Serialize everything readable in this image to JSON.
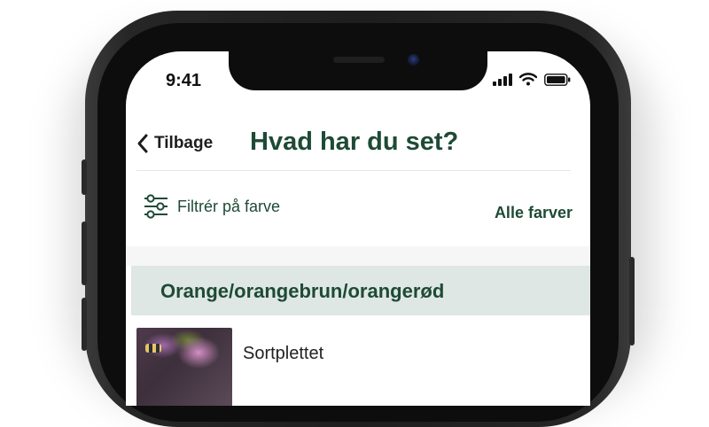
{
  "status_bar": {
    "time": "9:41"
  },
  "header": {
    "back_label": "Tilbage",
    "title": "Hvad har du set?"
  },
  "filter": {
    "label": "Filtrér på farve",
    "value": "Alle farver"
  },
  "sections": [
    {
      "title": "Orange/orangebrun/orangerød",
      "items": [
        {
          "name": "Sortplettet"
        }
      ]
    }
  ],
  "colors": {
    "accent": "#1e4a36",
    "section_bg": "#dfe7e4",
    "phone_frame": "#1e1e1e"
  }
}
